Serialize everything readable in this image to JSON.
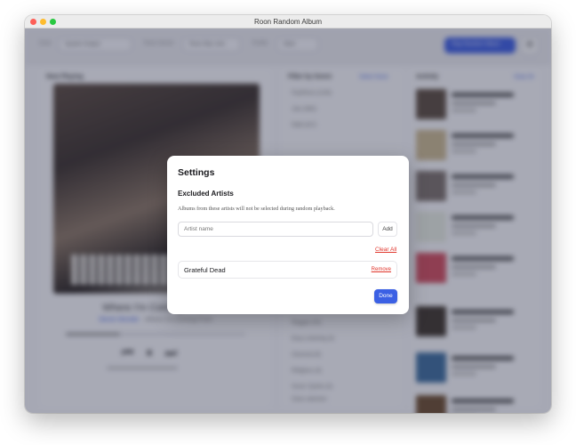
{
  "window": {
    "title": "Roon Random Album"
  },
  "toolbar": {
    "zone_label": "Zone",
    "zone_value": "System Output",
    "genre_label": "Roon Server",
    "genre_value": "Roon Mac mini",
    "profile_label": "Profile",
    "profile_value": "Mark",
    "play_button": "Play Random Album",
    "settings_icon": "gear-icon"
  },
  "now_playing": {
    "title": "Now Playing",
    "track": "Where I'm Coming From",
    "artist": "Stevie Wonder",
    "album": " · Where I'm Coming From",
    "time_elapsed": "1:12",
    "time_total": "4:05"
  },
  "filter": {
    "title": "Filter by Genre",
    "select_none": "Select None",
    "genres": [
      "Pop/Rock (1234)",
      "Jazz (862)",
      "R&B (427)",
      "Reggae (54)",
      "Easy Listening (3)",
      "Classical (9)",
      "Religious (4)",
      "Vocal / Quirks (3)"
    ],
    "footer": "Clear selection"
  },
  "activity": {
    "title": "Activity",
    "clear": "Clear All",
    "thumb_colors": [
      "#5a4a3c",
      "#c9b68d",
      "#7a6e68",
      "#e6eadf",
      "#cf4a5a",
      "#3c3228",
      "#3a6a9a",
      "#6a4a2a"
    ]
  },
  "modal": {
    "title": "Settings",
    "section_title": "Excluded Artists",
    "section_desc": "Albums from these artists will not be selected during random playback.",
    "input_placeholder": "Artist name",
    "add_label": "Add",
    "clear_all_label": "Clear All",
    "excluded_artists": [
      {
        "name": "Grateful Dead",
        "remove_label": "Remove"
      }
    ],
    "done_label": "Done"
  },
  "colors": {
    "accent": "#3b60e4",
    "danger": "#e0352b"
  }
}
